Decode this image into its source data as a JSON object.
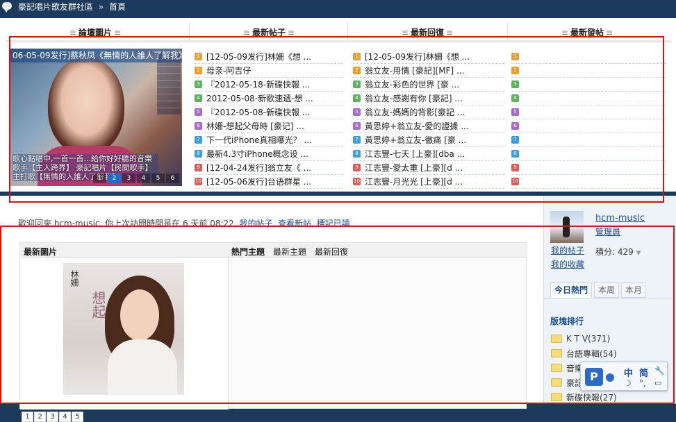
{
  "breadcrumb": {
    "site": "豪記唱片歌友群社區",
    "sep": "»",
    "home": "首頁"
  },
  "columns": [
    {
      "title": "論壇圖片"
    },
    {
      "title": "最新帖子"
    },
    {
      "title": "最新回復"
    },
    {
      "title": "最新發帖"
    }
  ],
  "header_decor": "≡",
  "slideshow": {
    "caption": "06-05-09发行]蔡秋凤《無情的人誰人了解我》",
    "blurb": [
      "歌心點唱中,一首一首...給你好好聽的音樂",
      "歌手【主人跨界】 豪記唱片【民間歌手】",
      "主打歌【無情的人誰人了解我】"
    ],
    "pages": [
      "1",
      "2",
      "3",
      "4",
      "5",
      "6"
    ],
    "active_page": "2"
  },
  "latest_posts": [
    {
      "n": "1",
      "text": "[12-05-09发行]林姍《想 ...",
      "color": "#e8a23a"
    },
    {
      "n": "2",
      "text": "母亲-阿吉仔",
      "color": "#f09b2a"
    },
    {
      "n": "3",
      "text": "『2012-05-18-新碟快報 ...",
      "color": "#5db35d"
    },
    {
      "n": "4",
      "text": "2012-05-08-新歌速遞-想 ...",
      "color": "#5db35d"
    },
    {
      "n": "5",
      "text": "『2012-05-08-新碟快報 ...",
      "color": "#a86bcc"
    },
    {
      "n": "6",
      "text": "林姍-想起父母時 [豪记] ...",
      "color": "#a86bcc"
    },
    {
      "n": "7",
      "text": "下一代iPhone真相曝光？ ...",
      "color": "#3aa0e0"
    },
    {
      "n": "8",
      "text": "最新4.3寸iPhone概念设 ...",
      "color": "#3aa0e0"
    },
    {
      "n": "9",
      "text": "[12-04-24发行]翁立友《 ...",
      "color": "#e05a5a"
    },
    {
      "n": "10",
      "text": "[12-05-06发行]台语群星 ...",
      "color": "#e05a5a"
    }
  ],
  "latest_replies": [
    {
      "n": "1",
      "text": "[12-05-09发行]林姍《想 ...",
      "color": "#e8a23a"
    },
    {
      "n": "2",
      "text": "翁立友-用情 [豪記][MF] ...",
      "color": "#f09b2a"
    },
    {
      "n": "3",
      "text": "翁立友-彩色的世界 [豪 ...",
      "color": "#5db35d"
    },
    {
      "n": "4",
      "text": "翁立友-感謝有你 [豪記] ...",
      "color": "#5db35d"
    },
    {
      "n": "5",
      "text": "翁立友-媽媽的背影[豪記 ...",
      "color": "#a86bcc"
    },
    {
      "n": "6",
      "text": "黃思婷+翁立友-愛的證據 ...",
      "color": "#a86bcc"
    },
    {
      "n": "7",
      "text": "黃思婷+翁立友-徹痛 [豪 ...",
      "color": "#3aa0e0"
    },
    {
      "n": "8",
      "text": "江志豐-七天 [上豪][dba ...",
      "color": "#3aa0e0"
    },
    {
      "n": "9",
      "text": "江志豐-愛太重 [上豪][d ...",
      "color": "#e05a5a"
    },
    {
      "n": "10",
      "text": "江志豐-月光光 [上豪][d ...",
      "color": "#e05a5a"
    }
  ],
  "latest_threads": [
    {
      "n": "1",
      "color": "#e8a23a"
    },
    {
      "n": "2",
      "color": "#f09b2a"
    },
    {
      "n": "3",
      "color": "#5db35d"
    },
    {
      "n": "4",
      "color": "#5db35d"
    },
    {
      "n": "5",
      "color": "#a86bcc"
    },
    {
      "n": "6",
      "color": "#a86bcc"
    },
    {
      "n": "7",
      "color": "#3aa0e0"
    },
    {
      "n": "8",
      "color": "#3aa0e0"
    },
    {
      "n": "9",
      "color": "#e05a5a"
    },
    {
      "n": "10",
      "color": "#e05a5a"
    }
  ],
  "welcome": {
    "text": "歡迎回來 hcm-music, 你上次訪問時間是在 6 天前 08:22,",
    "link_myposts": "我的帖子",
    "link_new": "查看新帖",
    "link_read": "標記已讀"
  },
  "latest_box": {
    "pic_title": "最新圖片",
    "tabs": [
      "熱門主題",
      "最新主題",
      "最新回復"
    ],
    "cover_text_v1": "林姍",
    "cover_text_v2": "想起",
    "pages": [
      "1",
      "2",
      "3",
      "4",
      "5"
    ]
  },
  "sidebar": {
    "username": "hcm-music",
    "role": "管理員",
    "my_posts": "我的帖子",
    "my_favorites": "我的收藏",
    "points_label": "積分: 429",
    "tabs": [
      "今日熱門",
      "本周",
      "本月"
    ],
    "rank_title": "版塊排行",
    "ranks": [
      "K T V(371)",
      "台語專輯(54)",
      "音樂",
      "豪記",
      "新碟快報(27)"
    ]
  },
  "ime": {
    "c1": "中",
    "c2": "简",
    "c3": "🔧",
    "c4": "☽",
    "c5": "°,",
    "c6": "▭"
  },
  "colors": {
    "topbar": "#1c3a5c",
    "link": "#1a4e96",
    "highlight_box": "#e01010"
  }
}
